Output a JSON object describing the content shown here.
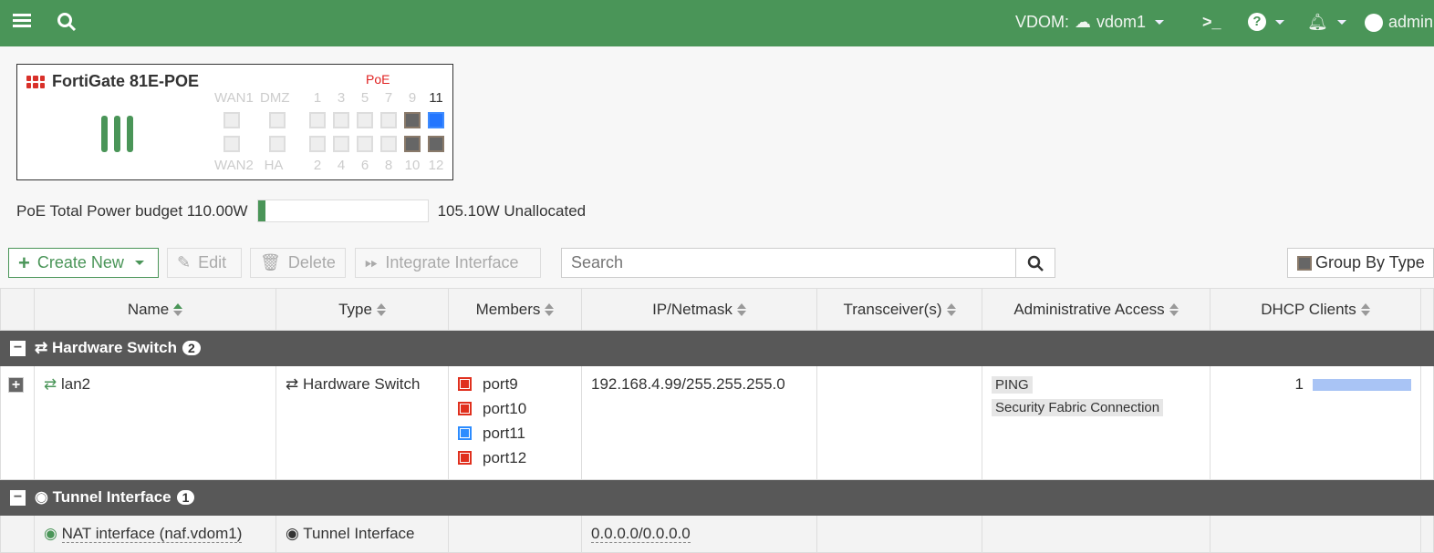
{
  "topbar": {
    "vdom_label": "VDOM:",
    "vdom": "vdom1",
    "user": "admin"
  },
  "device": {
    "name": "FortiGate 81E-POE",
    "poe_label": "PoE",
    "top_labels": [
      "WAN1",
      "DMZ",
      "1",
      "3",
      "5",
      "7",
      "9",
      "11"
    ],
    "bottom_labels": [
      "WAN2",
      "HA",
      "2",
      "4",
      "6",
      "8",
      "10",
      "12"
    ]
  },
  "poe_budget": {
    "label": "PoE Total Power budget 110.00W",
    "unallocated": "105.10W Unallocated",
    "used_fraction": 0.045,
    "color": "#4a9558"
  },
  "toolbar": {
    "create_new": "Create New",
    "edit": "Edit",
    "delete": "Delete",
    "integrate": "Integrate Interface",
    "search_placeholder": "Search",
    "group_by": "Group By Type"
  },
  "columns": [
    "Name",
    "Type",
    "Members",
    "IP/Netmask",
    "Transceiver(s)",
    "Administrative Access",
    "DHCP Clients"
  ],
  "groups": [
    {
      "title": "Hardware Switch",
      "count": "2",
      "rows": [
        {
          "name": "lan2",
          "type": "Hardware Switch",
          "members": [
            "port9",
            "port10",
            "port11",
            "port12"
          ],
          "ip": "192.168.4.99/255.255.255.0",
          "access": [
            "PING",
            "Security Fabric Connection"
          ],
          "dhcp": "1"
        }
      ]
    },
    {
      "title": "Tunnel Interface",
      "count": "1",
      "rows": [
        {
          "name": "NAT interface (naf.vdom1)",
          "type": "Tunnel Interface",
          "ip": "0.0.0.0/0.0.0.0"
        }
      ]
    }
  ]
}
